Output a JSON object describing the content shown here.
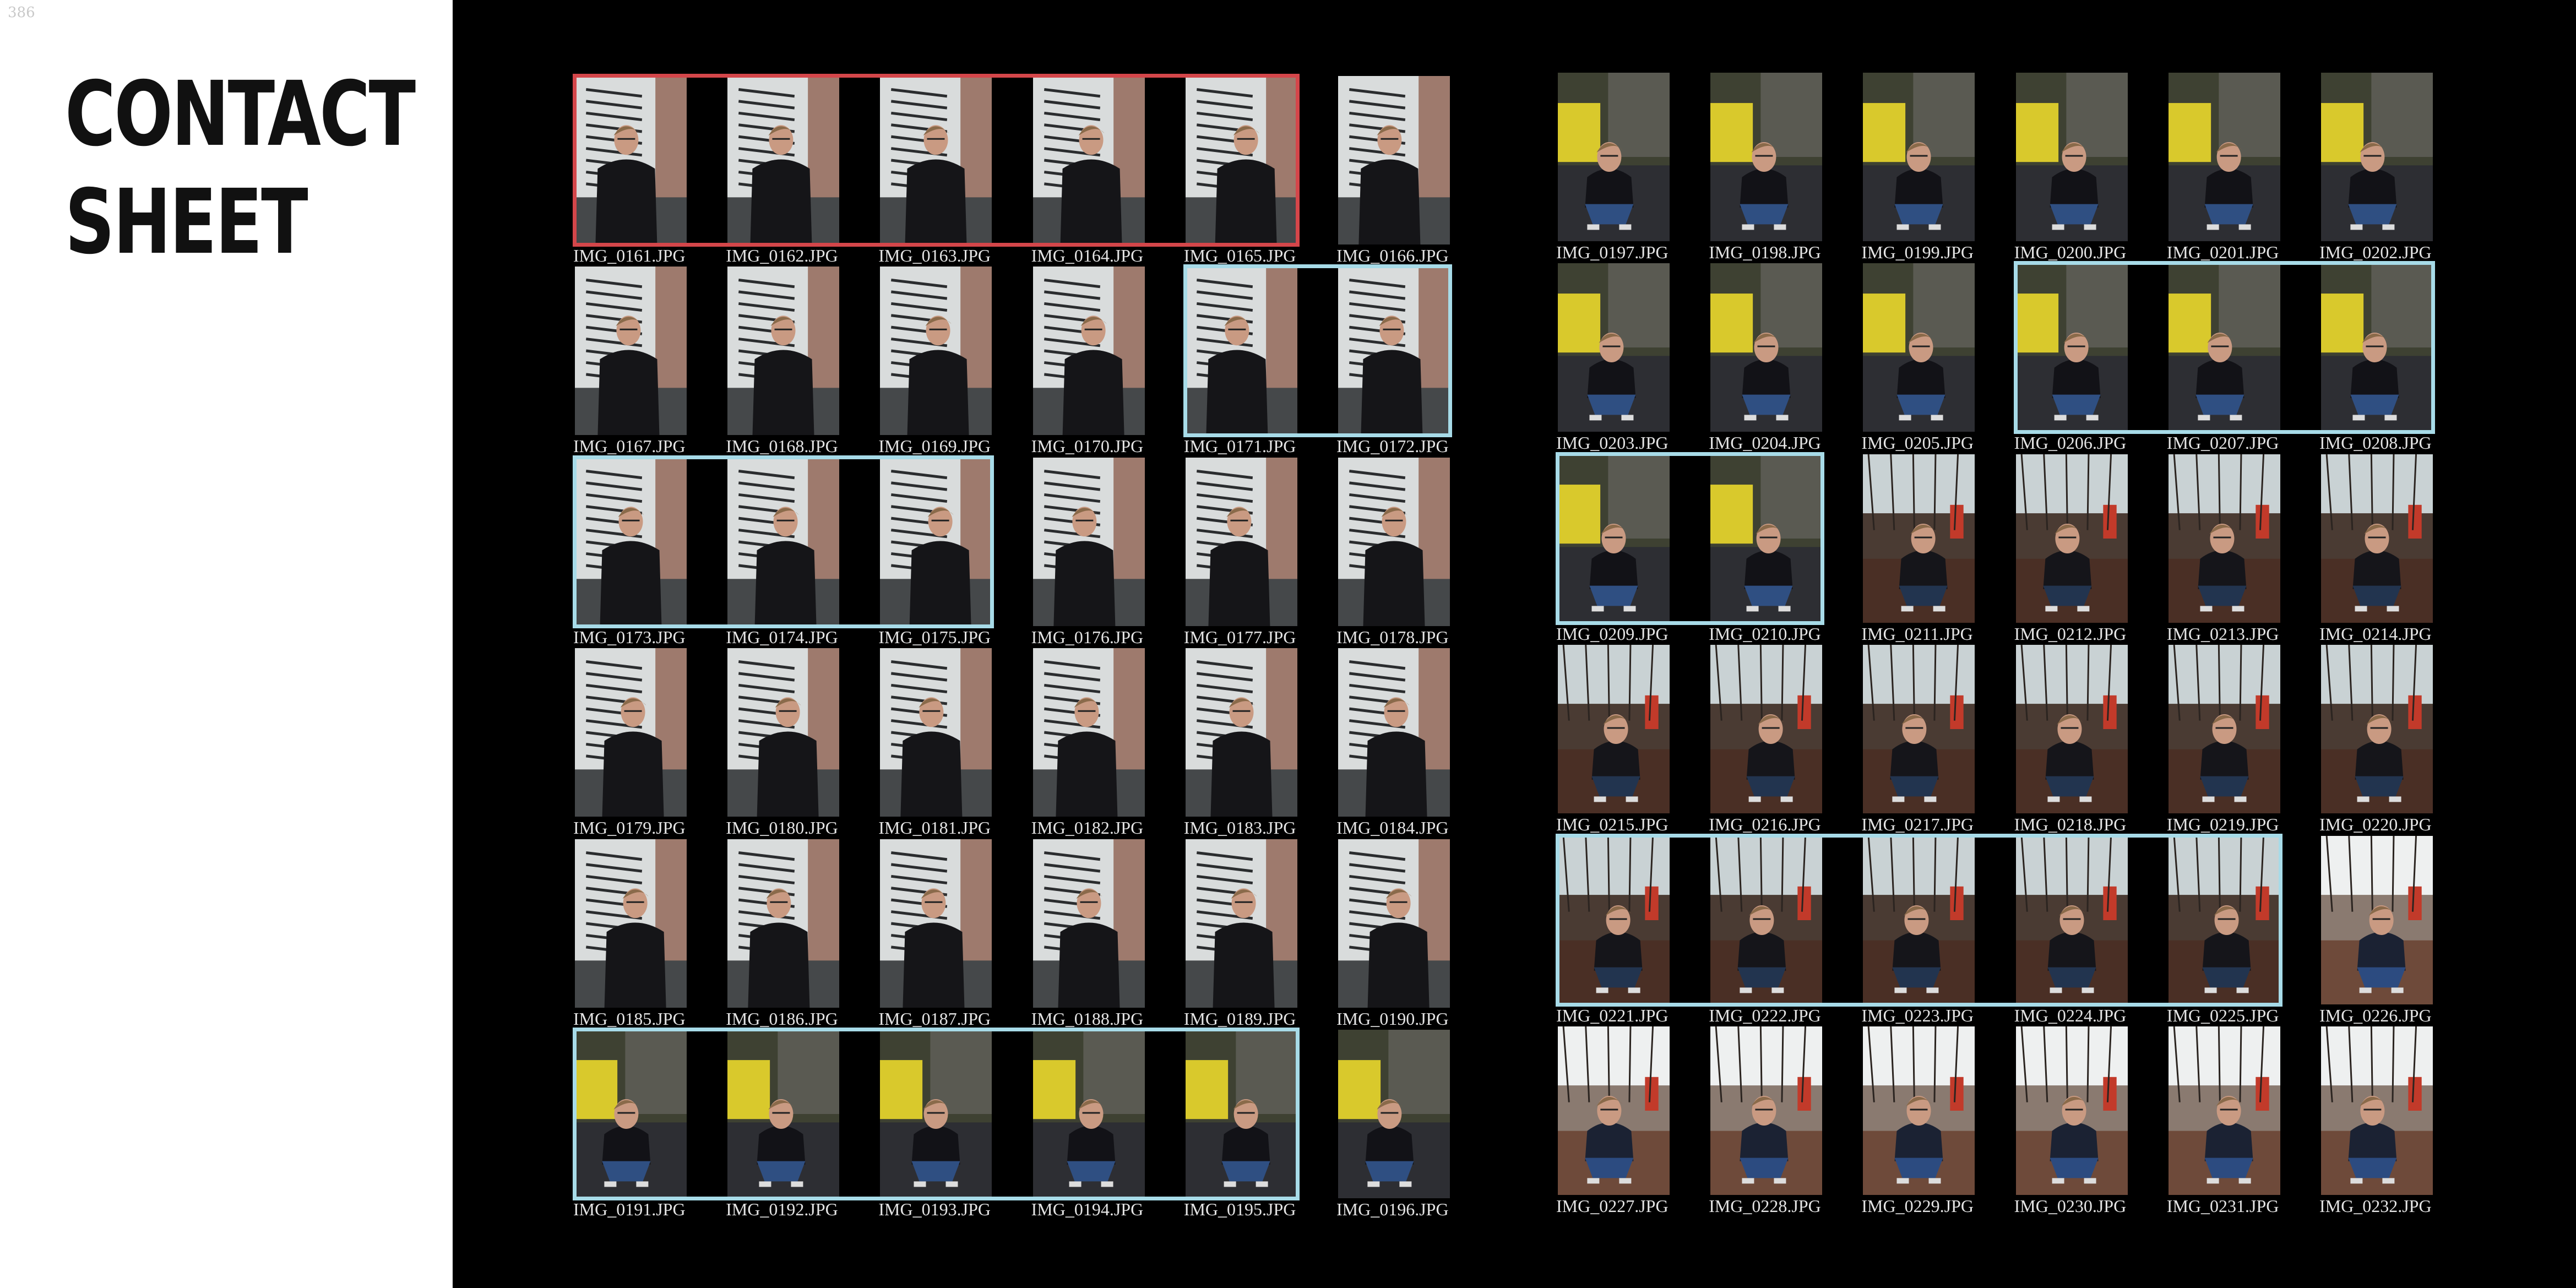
{
  "page": {
    "number": "386",
    "title_line1": "CONTACT",
    "title_line2": "SHEET"
  },
  "colors": {
    "background": "#000000",
    "panel": "#ffffff",
    "selection_red": "#d4464a",
    "selection_blue": "#a7dbe8"
  },
  "scenes": {
    "stairs": {
      "sky": "#d9dcdc",
      "mid": "#6d7173",
      "ground": "#45484a",
      "coat": "#151518",
      "trousers": "#151518",
      "accent": "#8a5a48"
    },
    "yard": {
      "sky": "#3e4132",
      "mid": "#5a5a52",
      "ground": "#2d2e33",
      "coat": "#121217",
      "trousers": "#2f4f82",
      "accent": "#d9c92c"
    },
    "leaves": {
      "sky": "#c9d2d4",
      "mid": "#4a3b33",
      "ground": "#4a2f25",
      "coat": "#15151a",
      "trousers": "#22344f",
      "accent": "#c23a2a"
    },
    "leaves-light": {
      "sky": "#eef0f0",
      "mid": "#8a7a70",
      "ground": "#6e4a3a",
      "coat": "#1b2233",
      "trousers": "#2c4b80",
      "accent": "#c23a2a"
    }
  },
  "contact_sheet": {
    "left": [
      [
        {
          "file": "IMG_0161.JPG",
          "scene": "stairs"
        },
        {
          "file": "IMG_0162.JPG",
          "scene": "stairs"
        },
        {
          "file": "IMG_0163.JPG",
          "scene": "stairs"
        },
        {
          "file": "IMG_0164.JPG",
          "scene": "stairs"
        },
        {
          "file": "IMG_0165.JPG",
          "scene": "stairs"
        },
        {
          "file": "IMG_0166.JPG",
          "scene": "stairs"
        }
      ],
      [
        {
          "file": "IMG_0167.JPG",
          "scene": "stairs"
        },
        {
          "file": "IMG_0168.JPG",
          "scene": "stairs"
        },
        {
          "file": "IMG_0169.JPG",
          "scene": "stairs"
        },
        {
          "file": "IMG_0170.JPG",
          "scene": "stairs"
        },
        {
          "file": "IMG_0171.JPG",
          "scene": "stairs"
        },
        {
          "file": "IMG_0172.JPG",
          "scene": "stairs"
        }
      ],
      [
        {
          "file": "IMG_0173.JPG",
          "scene": "stairs"
        },
        {
          "file": "IMG_0174.JPG",
          "scene": "stairs"
        },
        {
          "file": "IMG_0175.JPG",
          "scene": "stairs"
        },
        {
          "file": "IMG_0176.JPG",
          "scene": "stairs"
        },
        {
          "file": "IMG_0177.JPG",
          "scene": "stairs"
        },
        {
          "file": "IMG_0178.JPG",
          "scene": "stairs"
        }
      ],
      [
        {
          "file": "IMG_0179.JPG",
          "scene": "stairs"
        },
        {
          "file": "IMG_0180.JPG",
          "scene": "stairs"
        },
        {
          "file": "IMG_0181.JPG",
          "scene": "stairs"
        },
        {
          "file": "IMG_0182.JPG",
          "scene": "stairs"
        },
        {
          "file": "IMG_0183.JPG",
          "scene": "stairs"
        },
        {
          "file": "IMG_0184.JPG",
          "scene": "stairs"
        }
      ],
      [
        {
          "file": "IMG_0185.JPG",
          "scene": "stairs"
        },
        {
          "file": "IMG_0186.JPG",
          "scene": "stairs"
        },
        {
          "file": "IMG_0187.JPG",
          "scene": "stairs"
        },
        {
          "file": "IMG_0188.JPG",
          "scene": "stairs"
        },
        {
          "file": "IMG_0189.JPG",
          "scene": "stairs"
        },
        {
          "file": "IMG_0190.JPG",
          "scene": "stairs"
        }
      ],
      [
        {
          "file": "IMG_0191.JPG",
          "scene": "yard"
        },
        {
          "file": "IMG_0192.JPG",
          "scene": "yard"
        },
        {
          "file": "IMG_0193.JPG",
          "scene": "yard"
        },
        {
          "file": "IMG_0194.JPG",
          "scene": "yard"
        },
        {
          "file": "IMG_0195.JPG",
          "scene": "yard"
        },
        {
          "file": "IMG_0196.JPG",
          "scene": "yard"
        }
      ]
    ],
    "right": [
      [
        {
          "file": "IMG_0197.JPG",
          "scene": "yard"
        },
        {
          "file": "IMG_0198.JPG",
          "scene": "yard"
        },
        {
          "file": "IMG_0199.JPG",
          "scene": "yard"
        },
        {
          "file": "IMG_0200.JPG",
          "scene": "yard"
        },
        {
          "file": "IMG_0201.JPG",
          "scene": "yard"
        },
        {
          "file": "IMG_0202.JPG",
          "scene": "yard"
        }
      ],
      [
        {
          "file": "IMG_0203.JPG",
          "scene": "yard"
        },
        {
          "file": "IMG_0204.JPG",
          "scene": "yard"
        },
        {
          "file": "IMG_0205.JPG",
          "scene": "yard"
        },
        {
          "file": "IMG_0206.JPG",
          "scene": "yard"
        },
        {
          "file": "IMG_0207.JPG",
          "scene": "yard"
        },
        {
          "file": "IMG_0208.JPG",
          "scene": "yard"
        }
      ],
      [
        {
          "file": "IMG_0209.JPG",
          "scene": "yard"
        },
        {
          "file": "IMG_0210.JPG",
          "scene": "yard"
        },
        {
          "file": "IMG_0211.JPG",
          "scene": "leaves"
        },
        {
          "file": "IMG_0212.JPG",
          "scene": "leaves"
        },
        {
          "file": "IMG_0213.JPG",
          "scene": "leaves"
        },
        {
          "file": "IMG_0214.JPG",
          "scene": "leaves"
        }
      ],
      [
        {
          "file": "IMG_0215.JPG",
          "scene": "leaves"
        },
        {
          "file": "IMG_0216.JPG",
          "scene": "leaves"
        },
        {
          "file": "IMG_0217.JPG",
          "scene": "leaves"
        },
        {
          "file": "IMG_0218.JPG",
          "scene": "leaves"
        },
        {
          "file": "IMG_0219.JPG",
          "scene": "leaves"
        },
        {
          "file": "IMG_0220.JPG",
          "scene": "leaves"
        }
      ],
      [
        {
          "file": "IMG_0221.JPG",
          "scene": "leaves"
        },
        {
          "file": "IMG_0222.JPG",
          "scene": "leaves"
        },
        {
          "file": "IMG_0223.JPG",
          "scene": "leaves"
        },
        {
          "file": "IMG_0224.JPG",
          "scene": "leaves"
        },
        {
          "file": "IMG_0225.JPG",
          "scene": "leaves"
        },
        {
          "file": "IMG_0226.JPG",
          "scene": "leaves-light"
        }
      ],
      [
        {
          "file": "IMG_0227.JPG",
          "scene": "leaves-light"
        },
        {
          "file": "IMG_0228.JPG",
          "scene": "leaves-light"
        },
        {
          "file": "IMG_0229.JPG",
          "scene": "leaves-light"
        },
        {
          "file": "IMG_0230.JPG",
          "scene": "leaves-light"
        },
        {
          "file": "IMG_0231.JPG",
          "scene": "leaves-light"
        },
        {
          "file": "IMG_0232.JPG",
          "scene": "leaves-light"
        }
      ]
    ],
    "selections": [
      {
        "color": "red",
        "first": "IMG_0161.JPG",
        "last": "IMG_0165.JPG"
      },
      {
        "color": "blue",
        "first": "IMG_0171.JPG",
        "last": "IMG_0172.JPG"
      },
      {
        "color": "blue",
        "first": "IMG_0173.JPG",
        "last": "IMG_0175.JPG"
      },
      {
        "color": "blue",
        "first": "IMG_0191.JPG",
        "last": "IMG_0195.JPG"
      },
      {
        "color": "blue",
        "first": "IMG_0206.JPG",
        "last": "IMG_0208.JPG"
      },
      {
        "color": "blue",
        "first": "IMG_0209.JPG",
        "last": "IMG_0210.JPG"
      },
      {
        "color": "blue",
        "first": "IMG_0221.JPG",
        "last": "IMG_0225.JPG"
      }
    ]
  }
}
